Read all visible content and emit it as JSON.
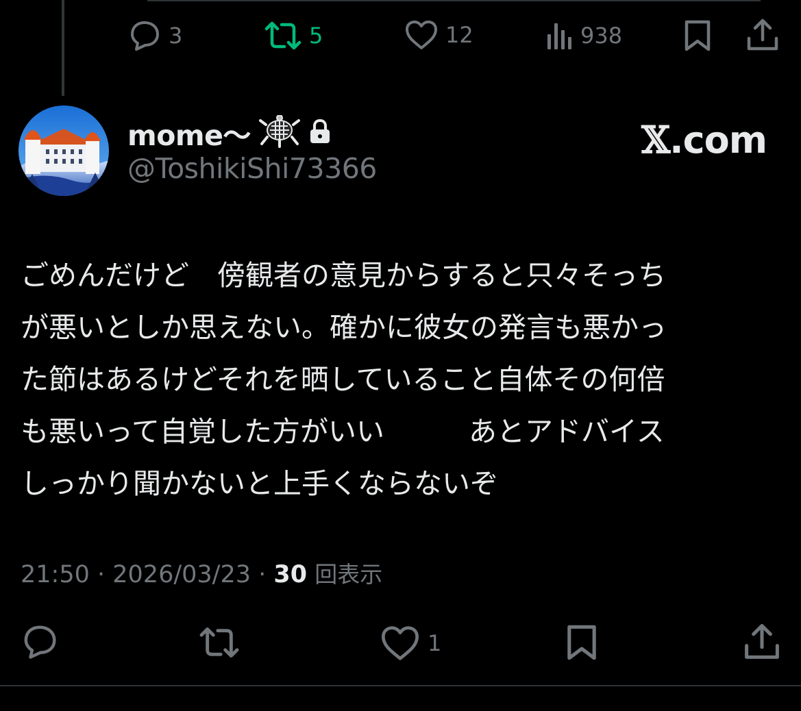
{
  "previous_post": {
    "replies": "3",
    "reposts": "5",
    "likes": "12",
    "views": "938"
  },
  "author": {
    "display_name": "mome〜",
    "handle": "@ToshikiShi73366",
    "badge_icon": "turtle-icon",
    "locked_icon": "lock-icon"
  },
  "brand": {
    "x_letter": "𝕏",
    "domain": ".com"
  },
  "post": {
    "line1": "ごめんだけど　傍観者の意見からすると只々そっち",
    "line2": "が悪いとしか思えない。確かに彼女の発言も悪かっ",
    "line3": "た節はあるけどそれを晒していること自体その何倍",
    "line4": "も悪いって自覚した方がいい　　　あとアドバイス",
    "line5": "しっかり聞かないと上手くならないぞ",
    "time": "21:50",
    "separator": " · ",
    "date": "2026/03/23",
    "views_count": "30",
    "views_label": "回表示"
  },
  "actions": {
    "likes": "1"
  },
  "colors": {
    "background": "#000000",
    "text_primary": "#e7e9ea",
    "text_secondary": "#71767b",
    "repost_active": "#00ba7c",
    "divider": "#2f3336"
  }
}
